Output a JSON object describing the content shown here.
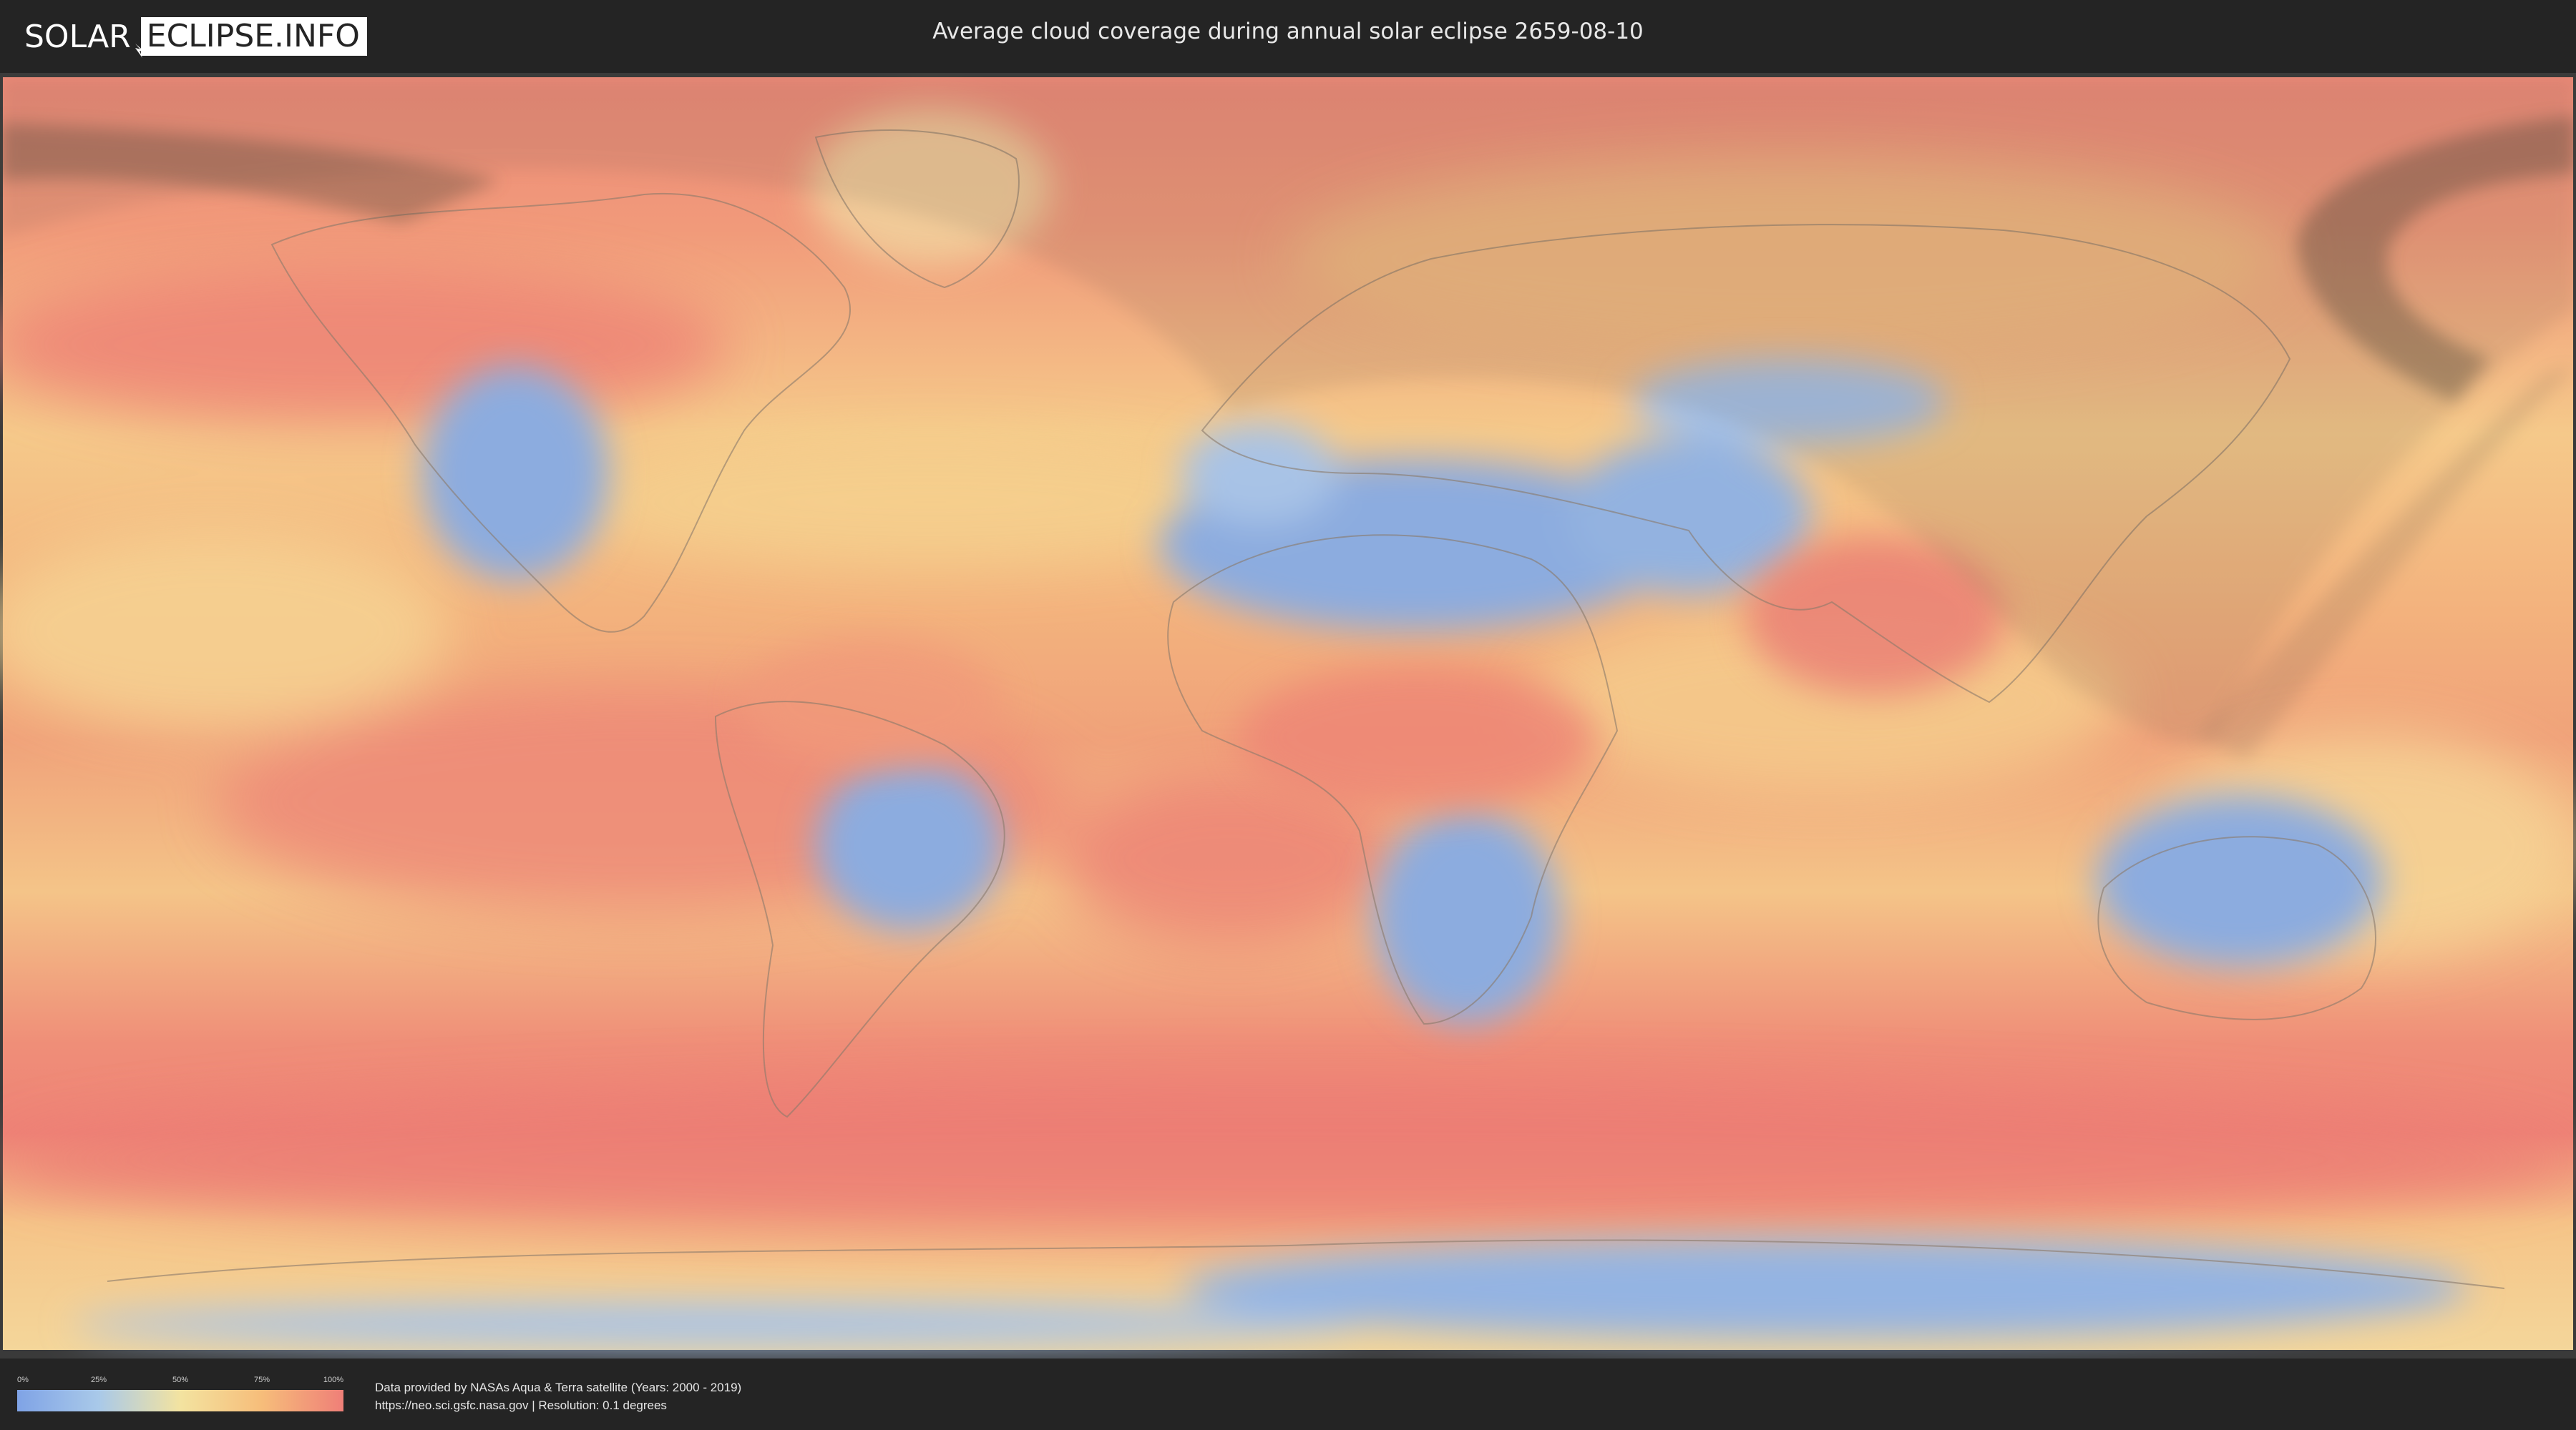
{
  "header": {
    "logo_left": "SOLAR",
    "logo_right": "ECLIPSE.INFO",
    "title": "Average cloud coverage during annual solar eclipse 2659-08-10"
  },
  "legend": {
    "ticks": [
      "0%",
      "25%",
      "50%",
      "75%",
      "100%"
    ],
    "colors": [
      "#7fa3e6",
      "#a9c9e9",
      "#f3e3a0",
      "#f6bd7a",
      "#ef7f78"
    ]
  },
  "credits": {
    "line1": "Data provided by NASAs Aqua & Terra satellite (Years: 2000 - 2019)",
    "line2": "https://neo.sci.gsfc.nasa.gov | Resolution: 0.1 degrees"
  },
  "map": {
    "ocean_color": "#f2b27e",
    "band_color": "#ee8a78",
    "dry_color": "#8cacdf",
    "eclipse_shadow_color": "#5a5046"
  }
}
